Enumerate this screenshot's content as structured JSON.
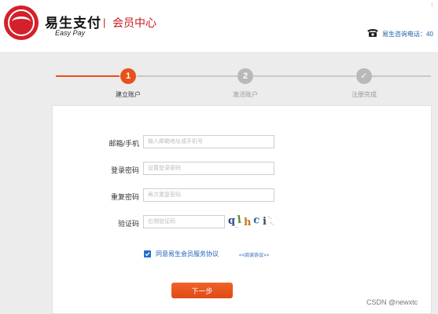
{
  "header": {
    "brand_cn": "易生支付",
    "brand_en": "Easy Pay",
    "separator": "|",
    "title": "会员中心",
    "hotline": "易生咨询电话：40",
    "top_dots": "⁝"
  },
  "steps": [
    {
      "number": "1",
      "label": "建立账户",
      "state": "active"
    },
    {
      "number": "2",
      "label": "激活账户",
      "state": "pending"
    },
    {
      "number": "✓",
      "label": "注册完成",
      "state": "pending"
    }
  ],
  "form": {
    "email": {
      "label": "邮箱/手机",
      "placeholder": "输入邮箱地址或手机号"
    },
    "password": {
      "label": "登录密码",
      "placeholder": "设置登录密码"
    },
    "repeat": {
      "label": "重复密码",
      "placeholder": "再次重复密码"
    },
    "captcha": {
      "label": "验证码",
      "placeholder": "右侧验证码",
      "code": "qlhci"
    },
    "agree_text": "同意易生会员服务协议",
    "agree_checked": true,
    "read_link": "<<阅读协议>>",
    "next_label": "下一步"
  },
  "watermark": "CSDN @newxtc",
  "colors": {
    "brand_red": "#c8161d",
    "step_orange": "#e8521a",
    "link_blue": "#1e5fb4",
    "hotline_blue": "#1a5fa8"
  }
}
